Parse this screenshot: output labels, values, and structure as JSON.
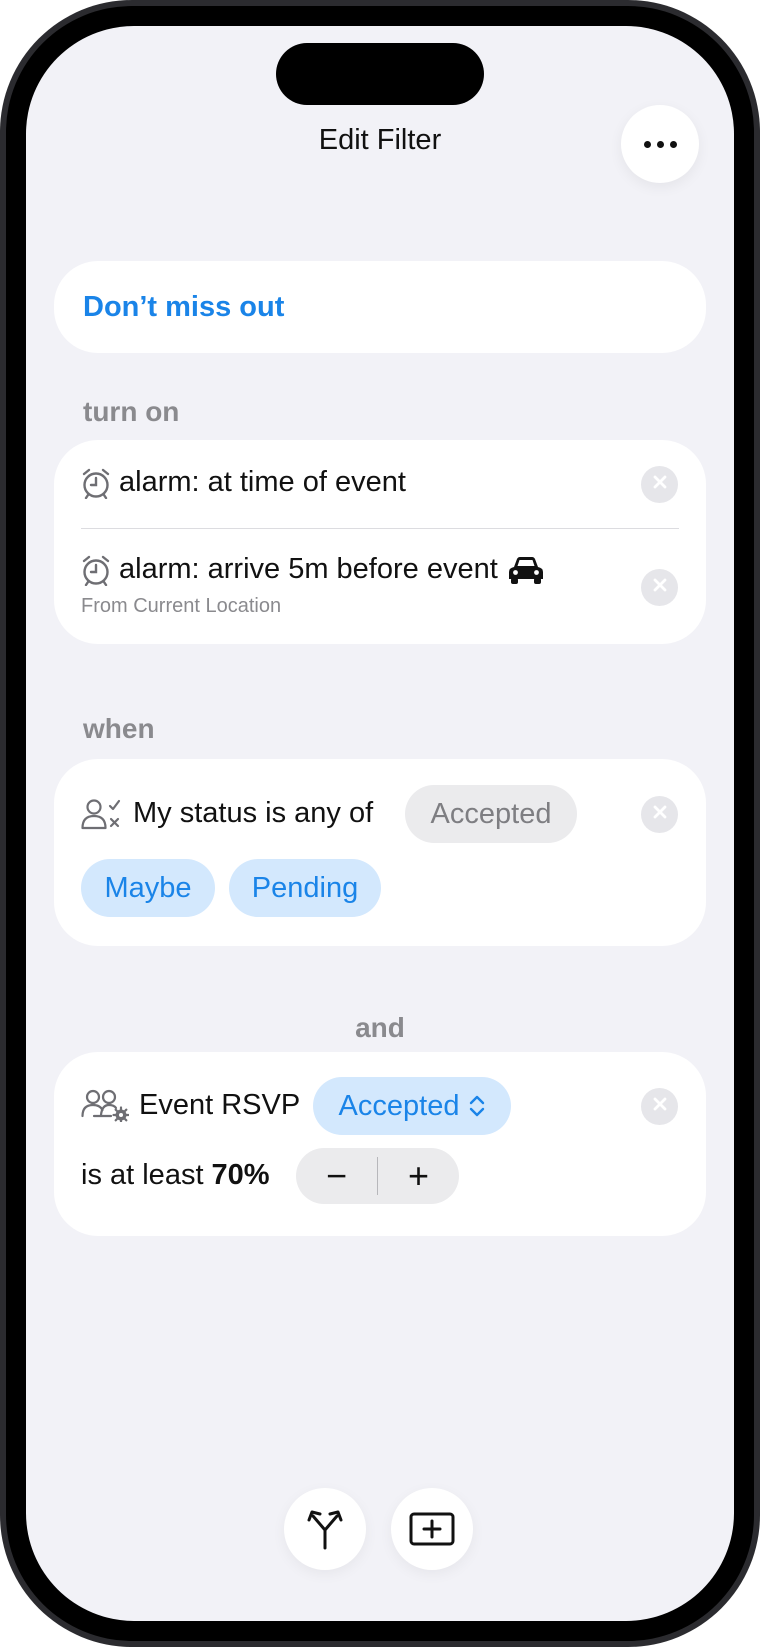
{
  "nav": {
    "title": "Edit Filter",
    "more_icon": "ellipsis-icon"
  },
  "filter_name": "Don’t miss out",
  "turn_on": {
    "label": "turn on",
    "items": [
      {
        "icon": "alarm-clock-icon",
        "text": "alarm: at time of event"
      },
      {
        "icon": "alarm-clock-icon",
        "text": "alarm: arrive 5m before event",
        "trailing_icon": "car-icon",
        "subtitle": "From Current Location"
      }
    ]
  },
  "when": {
    "label": "when",
    "icon": "person-check-icon",
    "text": "My status is any of",
    "chips": [
      {
        "label": "Accepted",
        "selected": false
      },
      {
        "label": "Maybe",
        "selected": true
      },
      {
        "label": "Pending",
        "selected": true
      }
    ]
  },
  "conjunction": "and",
  "rsvp": {
    "icon": "group-gear-icon",
    "text": "Event RSVP",
    "dropdown_value": "Accepted",
    "threshold_prefix": "is at least",
    "threshold_value": "70%",
    "minus_label": "−",
    "plus_label": "+"
  },
  "bottom_bar": {
    "branch_icon": "branch-icon",
    "add_icon": "add-card-icon"
  },
  "colors": {
    "accent": "#1a84e8",
    "background": "#f2f2f7",
    "secondary_text": "#8a8a8e",
    "chip_selected_bg": "#d3e8fd"
  }
}
